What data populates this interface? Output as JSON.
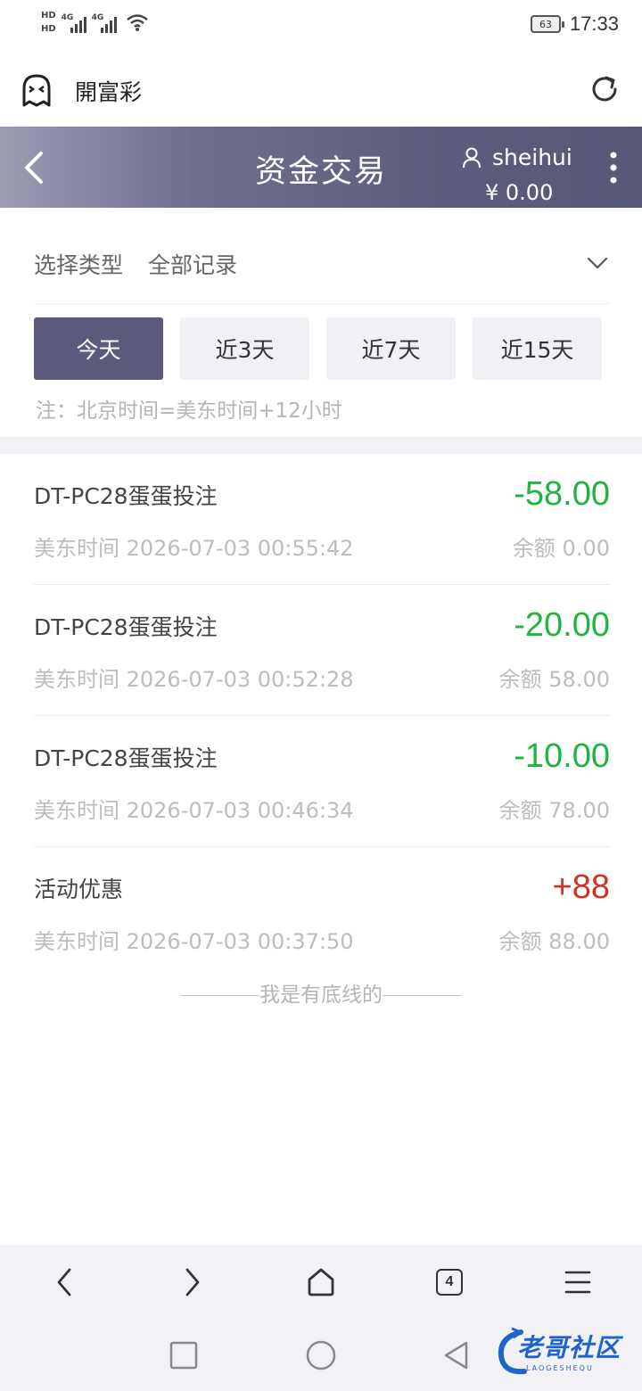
{
  "status_bar": {
    "hd1": "HD",
    "hd2": "HD",
    "net1": "4G",
    "net2": "4G",
    "battery": "63",
    "time": "17:33"
  },
  "browser": {
    "title": "開富彩"
  },
  "header": {
    "title": "资金交易",
    "username": "sheihui",
    "balance": "¥ 0.00"
  },
  "filter": {
    "type_label": "选择类型",
    "type_value": "全部记录",
    "ranges": [
      {
        "label": "今天",
        "active": true
      },
      {
        "label": "近3天",
        "active": false
      },
      {
        "label": "近7天",
        "active": false
      },
      {
        "label": "近15天",
        "active": false
      }
    ],
    "note": "注：北京时间=美东时间+12小时"
  },
  "records": [
    {
      "title": "DT-PC28蛋蛋投注",
      "time": "美东时间 2026-07-03 00:55:42",
      "amount": "-58.00",
      "balance": "余额 0.00"
    },
    {
      "title": "DT-PC28蛋蛋投注",
      "time": "美东时间 2026-07-03 00:52:28",
      "amount": "-20.00",
      "balance": "余额 58.00"
    },
    {
      "title": "DT-PC28蛋蛋投注",
      "time": "美东时间 2026-07-03 00:46:34",
      "amount": "-10.00",
      "balance": "余额 78.00"
    },
    {
      "title": "活动优惠",
      "time": "美东时间 2026-07-03 00:37:50",
      "amount": "+88",
      "balance": "余额 88.00"
    }
  ],
  "end_text": "我是有底线的",
  "browser_nav": {
    "tabs_count": "4"
  },
  "watermark": {
    "text": "老哥社区",
    "sub": "LAOGESHEQU"
  },
  "colors": {
    "header_start": "#9c9bb3",
    "header_end": "#585778",
    "active_tab": "#5b5a7c",
    "negative": "#1fb53f",
    "positive": "#d03224"
  }
}
